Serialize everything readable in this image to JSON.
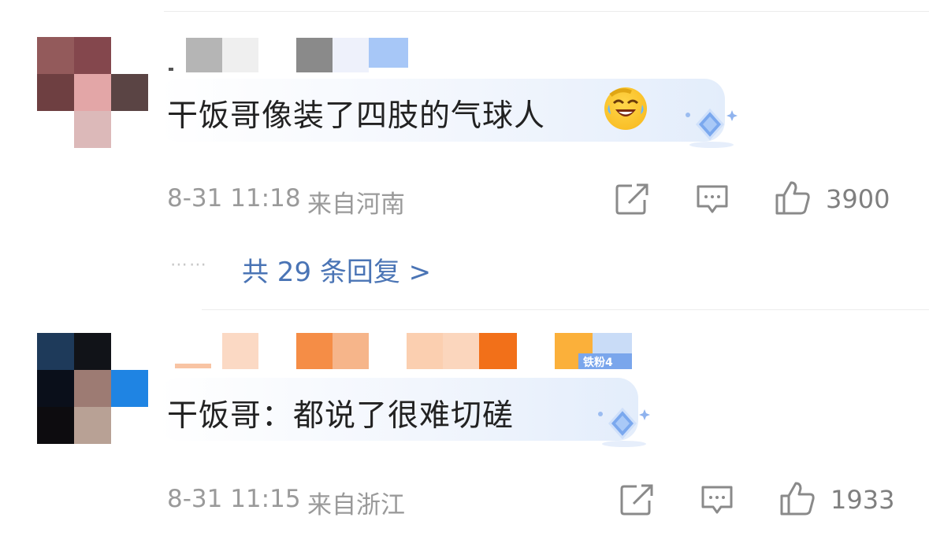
{
  "comments": [
    {
      "text": "干饭哥像装了四肢的气球人",
      "time": "8-31 11:18",
      "location": "来自河南",
      "likes": "3900",
      "emoji_icon": "laughing-crying-emoji-icon",
      "replies_label": "共 29 条回复 >",
      "replies_dots": "⋯⋯"
    },
    {
      "text": "干饭哥：都说了很难切磋",
      "time": "8-31 11:15",
      "location": "来自浙江",
      "likes": "1933",
      "badge_text": "铁粉4"
    }
  ],
  "colors": {
    "link_blue": "#4a74b5",
    "meta_gray": "#9a9a9a",
    "text_dark": "#222222"
  }
}
